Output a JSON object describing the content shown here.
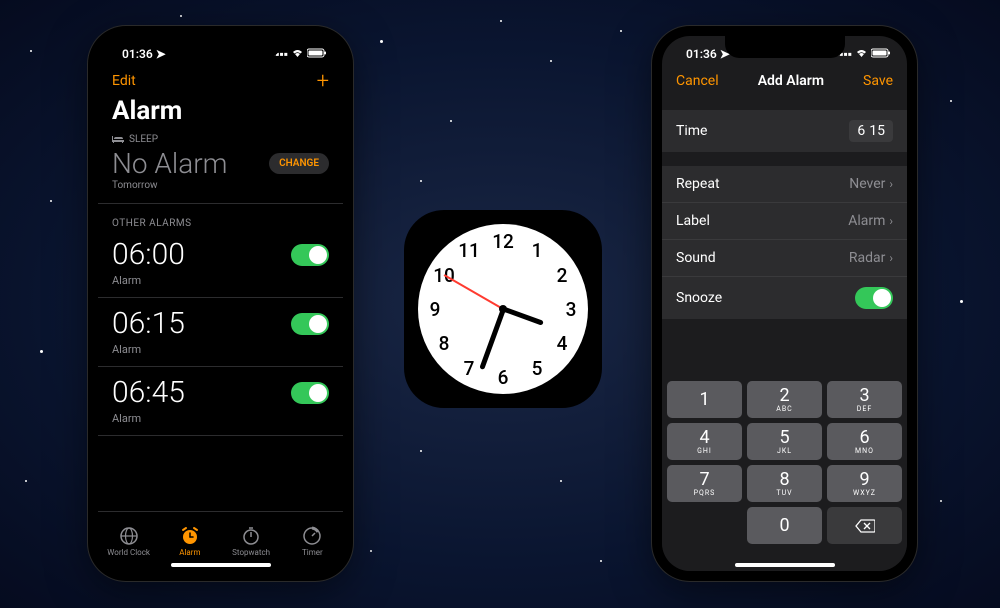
{
  "status": {
    "time": "01:36"
  },
  "left": {
    "edit": "Edit",
    "title": "Alarm",
    "sleep_label": "Sleep",
    "no_alarm": "No Alarm",
    "tomorrow": "Tomorrow",
    "change": "CHANGE",
    "other": "OTHER ALARMS",
    "alarms": [
      {
        "time": "06:00",
        "label": "Alarm",
        "on": true
      },
      {
        "time": "06:15",
        "label": "Alarm",
        "on": true
      },
      {
        "time": "06:45",
        "label": "Alarm",
        "on": true
      }
    ],
    "tabs": [
      {
        "label": "World Clock"
      },
      {
        "label": "Alarm"
      },
      {
        "label": "Stopwatch"
      },
      {
        "label": "Timer"
      }
    ]
  },
  "right": {
    "cancel": "Cancel",
    "title": "Add Alarm",
    "save": "Save",
    "time_label": "Time",
    "time_h": "6",
    "time_m": "15",
    "rows": [
      {
        "label": "Repeat",
        "value": "Never"
      },
      {
        "label": "Label",
        "value": "Alarm"
      },
      {
        "label": "Sound",
        "value": "Radar"
      },
      {
        "label": "Snooze",
        "value": ""
      }
    ],
    "keys": [
      {
        "n": "1",
        "s": ""
      },
      {
        "n": "2",
        "s": "ABC"
      },
      {
        "n": "3",
        "s": "DEF"
      },
      {
        "n": "4",
        "s": "GHI"
      },
      {
        "n": "5",
        "s": "JKL"
      },
      {
        "n": "6",
        "s": "MNO"
      },
      {
        "n": "7",
        "s": "PQRS"
      },
      {
        "n": "8",
        "s": "TUV"
      },
      {
        "n": "9",
        "s": "WXYZ"
      }
    ],
    "zero": "0"
  },
  "clock": {
    "numbers": [
      "12",
      "1",
      "2",
      "3",
      "4",
      "5",
      "6",
      "7",
      "8",
      "9",
      "10",
      "11"
    ],
    "hour_angle": 110,
    "minute_angle": 200,
    "second_angle": 300
  }
}
